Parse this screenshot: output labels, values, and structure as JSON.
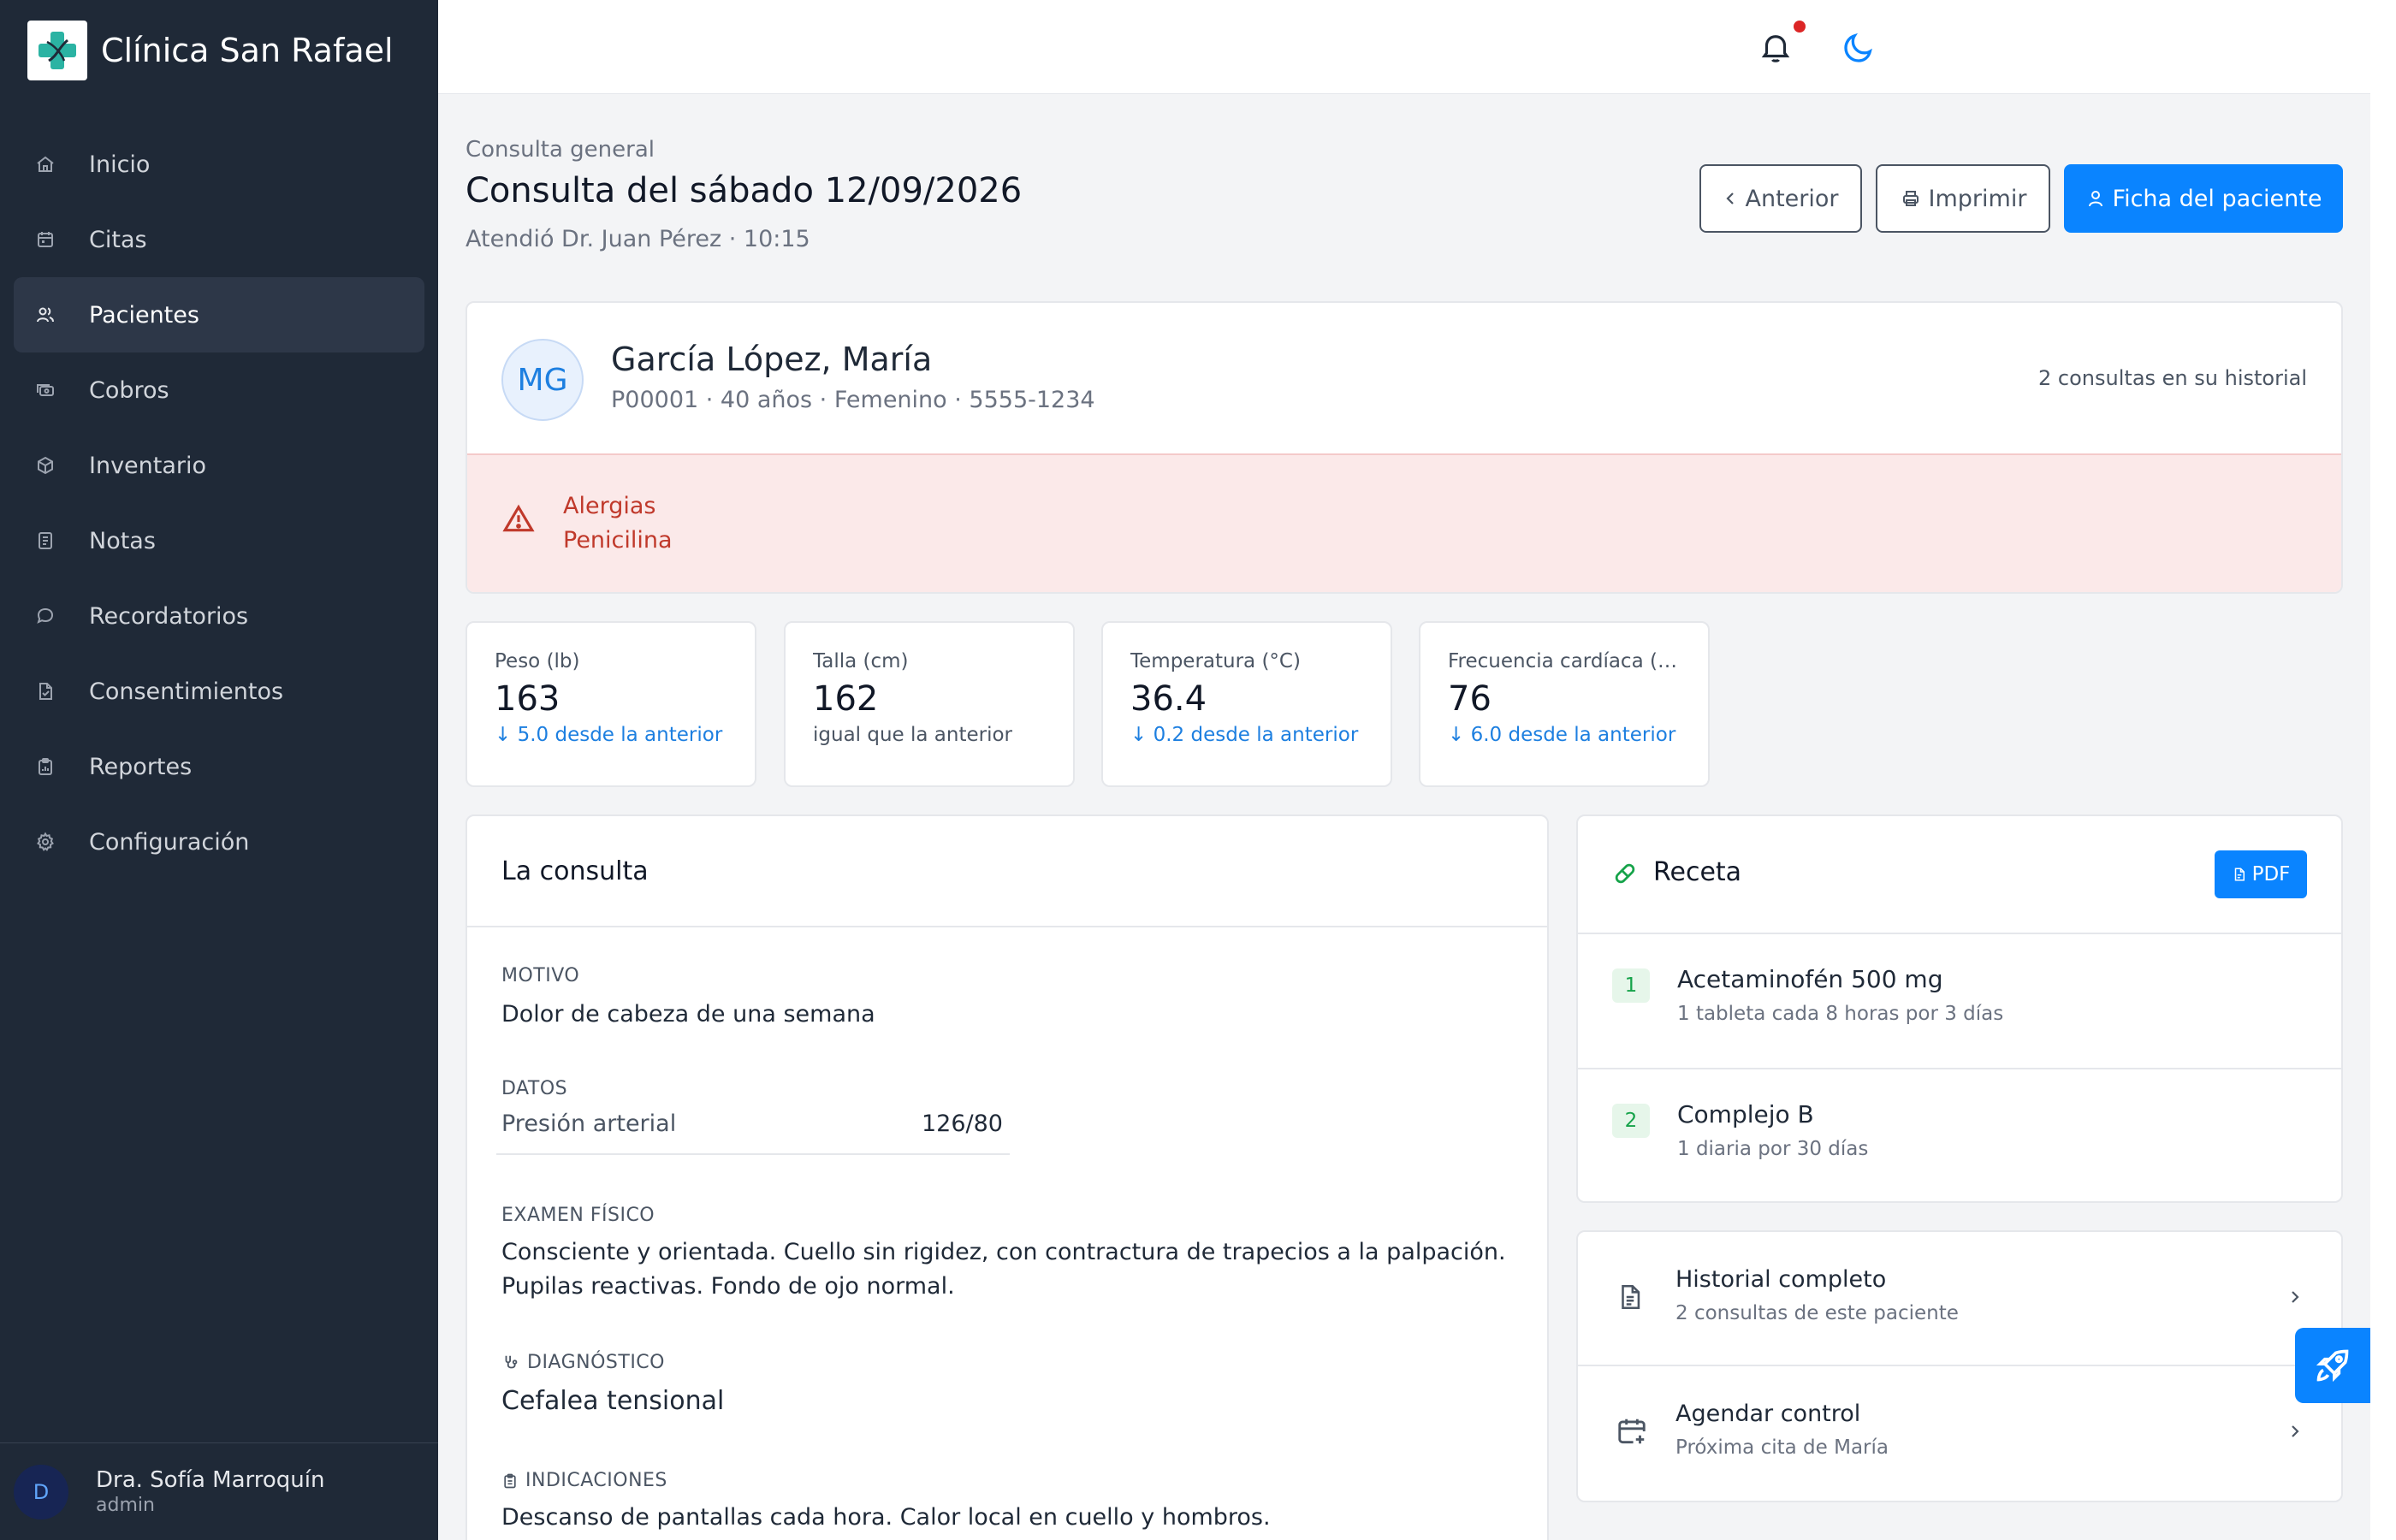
{
  "app": {
    "name": "Clínica San Rafael",
    "colors": {
      "accent": "#0a84ff",
      "sidebar": "#1f2937",
      "danger": "#c0392b",
      "success": "#16a34a"
    }
  },
  "sidebar": {
    "items": [
      {
        "label": "Inicio",
        "icon": "home-icon"
      },
      {
        "label": "Citas",
        "icon": "calendar-icon"
      },
      {
        "label": "Pacientes",
        "icon": "users-icon",
        "active": true
      },
      {
        "label": "Cobros",
        "icon": "cash-icon"
      },
      {
        "label": "Inventario",
        "icon": "box-icon"
      },
      {
        "label": "Notas",
        "icon": "notes-icon"
      },
      {
        "label": "Recordatorios",
        "icon": "chat-icon"
      },
      {
        "label": "Consentimientos",
        "icon": "file-check-icon"
      },
      {
        "label": "Reportes",
        "icon": "clipboard-icon"
      },
      {
        "label": "Configuración",
        "icon": "gear-icon"
      }
    ],
    "user": {
      "initial": "D",
      "name": "Dra. Sofía Marroquín",
      "role": "admin"
    }
  },
  "header": {
    "subtitle": "Consulta general",
    "title": "Consulta del sábado 12/09/2026",
    "attended": "Atendió Dr. Juan Pérez · 10:15",
    "buttons": {
      "previous": "Anterior",
      "print": "Imprimir",
      "patient_file": "Ficha del paciente"
    }
  },
  "patient": {
    "initials": "MG",
    "name": "García López, María",
    "meta": "P00001 · 40 años · Femenino · 5555-1234",
    "history": "2 consultas en su historial",
    "allergies_title": "Alergias",
    "allergies": "Penicilina"
  },
  "vitals": [
    {
      "label": "Peso (lb)",
      "value": "163",
      "delta": "↓ 5.0 desde la anterior",
      "trend": "down"
    },
    {
      "label": "Talla (cm)",
      "value": "162",
      "delta": "igual que la anterior",
      "trend": "same"
    },
    {
      "label": "Temperatura (°C)",
      "value": "36.4",
      "delta": "↓ 0.2 desde la anterior",
      "trend": "down"
    },
    {
      "label": "Frecuencia cardíaca (lpm)",
      "value": "76",
      "delta": "↓ 6.0 desde la anterior",
      "trend": "down"
    }
  ],
  "consulta": {
    "title": "La consulta",
    "motivo_label": "MOTIVO",
    "motivo": "Dolor de cabeza de una semana",
    "datos_label": "DATOS",
    "datos": [
      {
        "key": "Presión arterial",
        "value": "126/80"
      }
    ],
    "examen_label": "EXAMEN FÍSICO",
    "examen": "Consciente y orientada. Cuello sin rigidez, con contractura de trapecios a la palpación. Pupilas reactivas. Fondo de ojo normal.",
    "diagnostico_label": "DIAGNÓSTICO",
    "diagnostico": "Cefalea tensional",
    "indicaciones_label": "INDICACIONES",
    "indicaciones": "Descanso de pantallas cada hora. Calor local en cuello y hombros."
  },
  "receta": {
    "title": "Receta",
    "pdf": "PDF",
    "items": [
      {
        "num": "1",
        "name": "Acetaminofén 500 mg",
        "dose": "1 tableta cada 8 horas por 3 días"
      },
      {
        "num": "2",
        "name": "Complejo B",
        "dose": "1 diaria por 30 días"
      }
    ]
  },
  "links": [
    {
      "title": "Historial completo",
      "sub": "2 consultas de este paciente",
      "icon": "document-icon"
    },
    {
      "title": "Agendar control",
      "sub": "Próxima cita de María",
      "icon": "calendar-plus-icon"
    }
  ]
}
